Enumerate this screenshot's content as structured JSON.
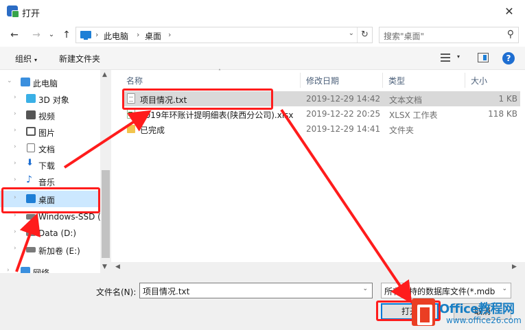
{
  "window": {
    "title": "打开",
    "close_glyph": "✕"
  },
  "nav": {
    "back": "←",
    "forward": "→",
    "dropdown": "⌄",
    "up": "↑",
    "refresh": "↻"
  },
  "address": {
    "crumbs": [
      "此电脑",
      "桌面"
    ],
    "separator": "›",
    "dropdown": "⌄"
  },
  "search": {
    "placeholder": "搜索\"桌面\"",
    "icon": "⚲"
  },
  "toolbar": {
    "organize": "组织",
    "new_folder": "新建文件夹",
    "caret": "▾",
    "help": "?"
  },
  "sidebar": {
    "items": [
      {
        "label": "此电脑",
        "icon": "computer-icon",
        "color": "#3a8fde"
      },
      {
        "label": "3D 对象",
        "icon": "cube-icon",
        "color": "#3ab0e6"
      },
      {
        "label": "视频",
        "icon": "video-icon",
        "color": "#555555"
      },
      {
        "label": "图片",
        "icon": "picture-icon",
        "color": "#555555"
      },
      {
        "label": "文档",
        "icon": "document-icon",
        "color": "#777777"
      },
      {
        "label": "下载",
        "icon": "download-icon",
        "color": "#1e6ed1"
      },
      {
        "label": "音乐",
        "icon": "music-icon",
        "color": "#1e6ed1"
      },
      {
        "label": "桌面",
        "icon": "desktop-icon",
        "color": "#1e7fd6"
      },
      {
        "label": "Windows-SSD (",
        "icon": "drive-icon",
        "color": "#7a7a7a"
      },
      {
        "label": "Data (D:)",
        "icon": "drive-icon",
        "color": "#7a7a7a"
      },
      {
        "label": "新加卷 (E:)",
        "icon": "drive-icon",
        "color": "#7a7a7a"
      },
      {
        "label": "网络",
        "icon": "network-icon",
        "color": "#3a8fde"
      }
    ],
    "chev_right": "›",
    "chev_down": "⌄",
    "scroll_up": "▲",
    "scroll_down": "▼"
  },
  "columns": {
    "name": "名称",
    "modified": "修改日期",
    "type": "类型",
    "size": "大小",
    "sort_indicator": "˄"
  },
  "files": [
    {
      "name": "项目情况.txt",
      "modified": "2019-12-29 14:42",
      "type": "文本文档",
      "size": "1 KB"
    },
    {
      "name": "2019年环账计提明细表(陕西分公司).xlsx",
      "modified": "2019-12-22 20:25",
      "type": "XLSX 工作表",
      "size": "118 KB"
    },
    {
      "name": "已完成",
      "modified": "2019-12-29 14:41",
      "type": "文件夹",
      "size": ""
    }
  ],
  "hscroll": {
    "left": "◀",
    "right": "▶"
  },
  "bottom": {
    "filename_label": "文件名(N):",
    "filename_value": "项目情况.txt",
    "filename_dd": "⌄",
    "filter_value": "所有支持的数据库文件(*.mdb *",
    "filter_dd": "⌄",
    "open_label": "打开",
    "cancel_label": "取消"
  },
  "annotation_color": "#ff1c1c",
  "watermark": {
    "brand": "Office教程网",
    "url": "www.office26.com"
  }
}
